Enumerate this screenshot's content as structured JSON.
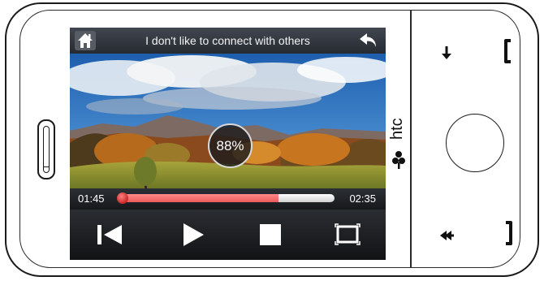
{
  "header": {
    "title": "I don't like to connect with others"
  },
  "overlay": {
    "percent": "88%"
  },
  "player": {
    "elapsed": "01:45",
    "total": "02:35",
    "progress": 0.74
  },
  "brand": {
    "logo_text": "htc"
  },
  "icons": {
    "home": "home-icon",
    "back": "back-arrow-icon",
    "previous": "skip-previous-icon",
    "play": "play-icon",
    "stop": "stop-icon",
    "fullscreen": "fullscreen-icon",
    "volume_down": "down-arrow-icon",
    "talk": "phone-talk-icon",
    "back_key": "back-key-icon",
    "end": "phone-end-icon"
  },
  "colors": {
    "progress_fill": "#e85a5a",
    "knob": "#c00000",
    "bar_bg": "#2a2d32"
  }
}
